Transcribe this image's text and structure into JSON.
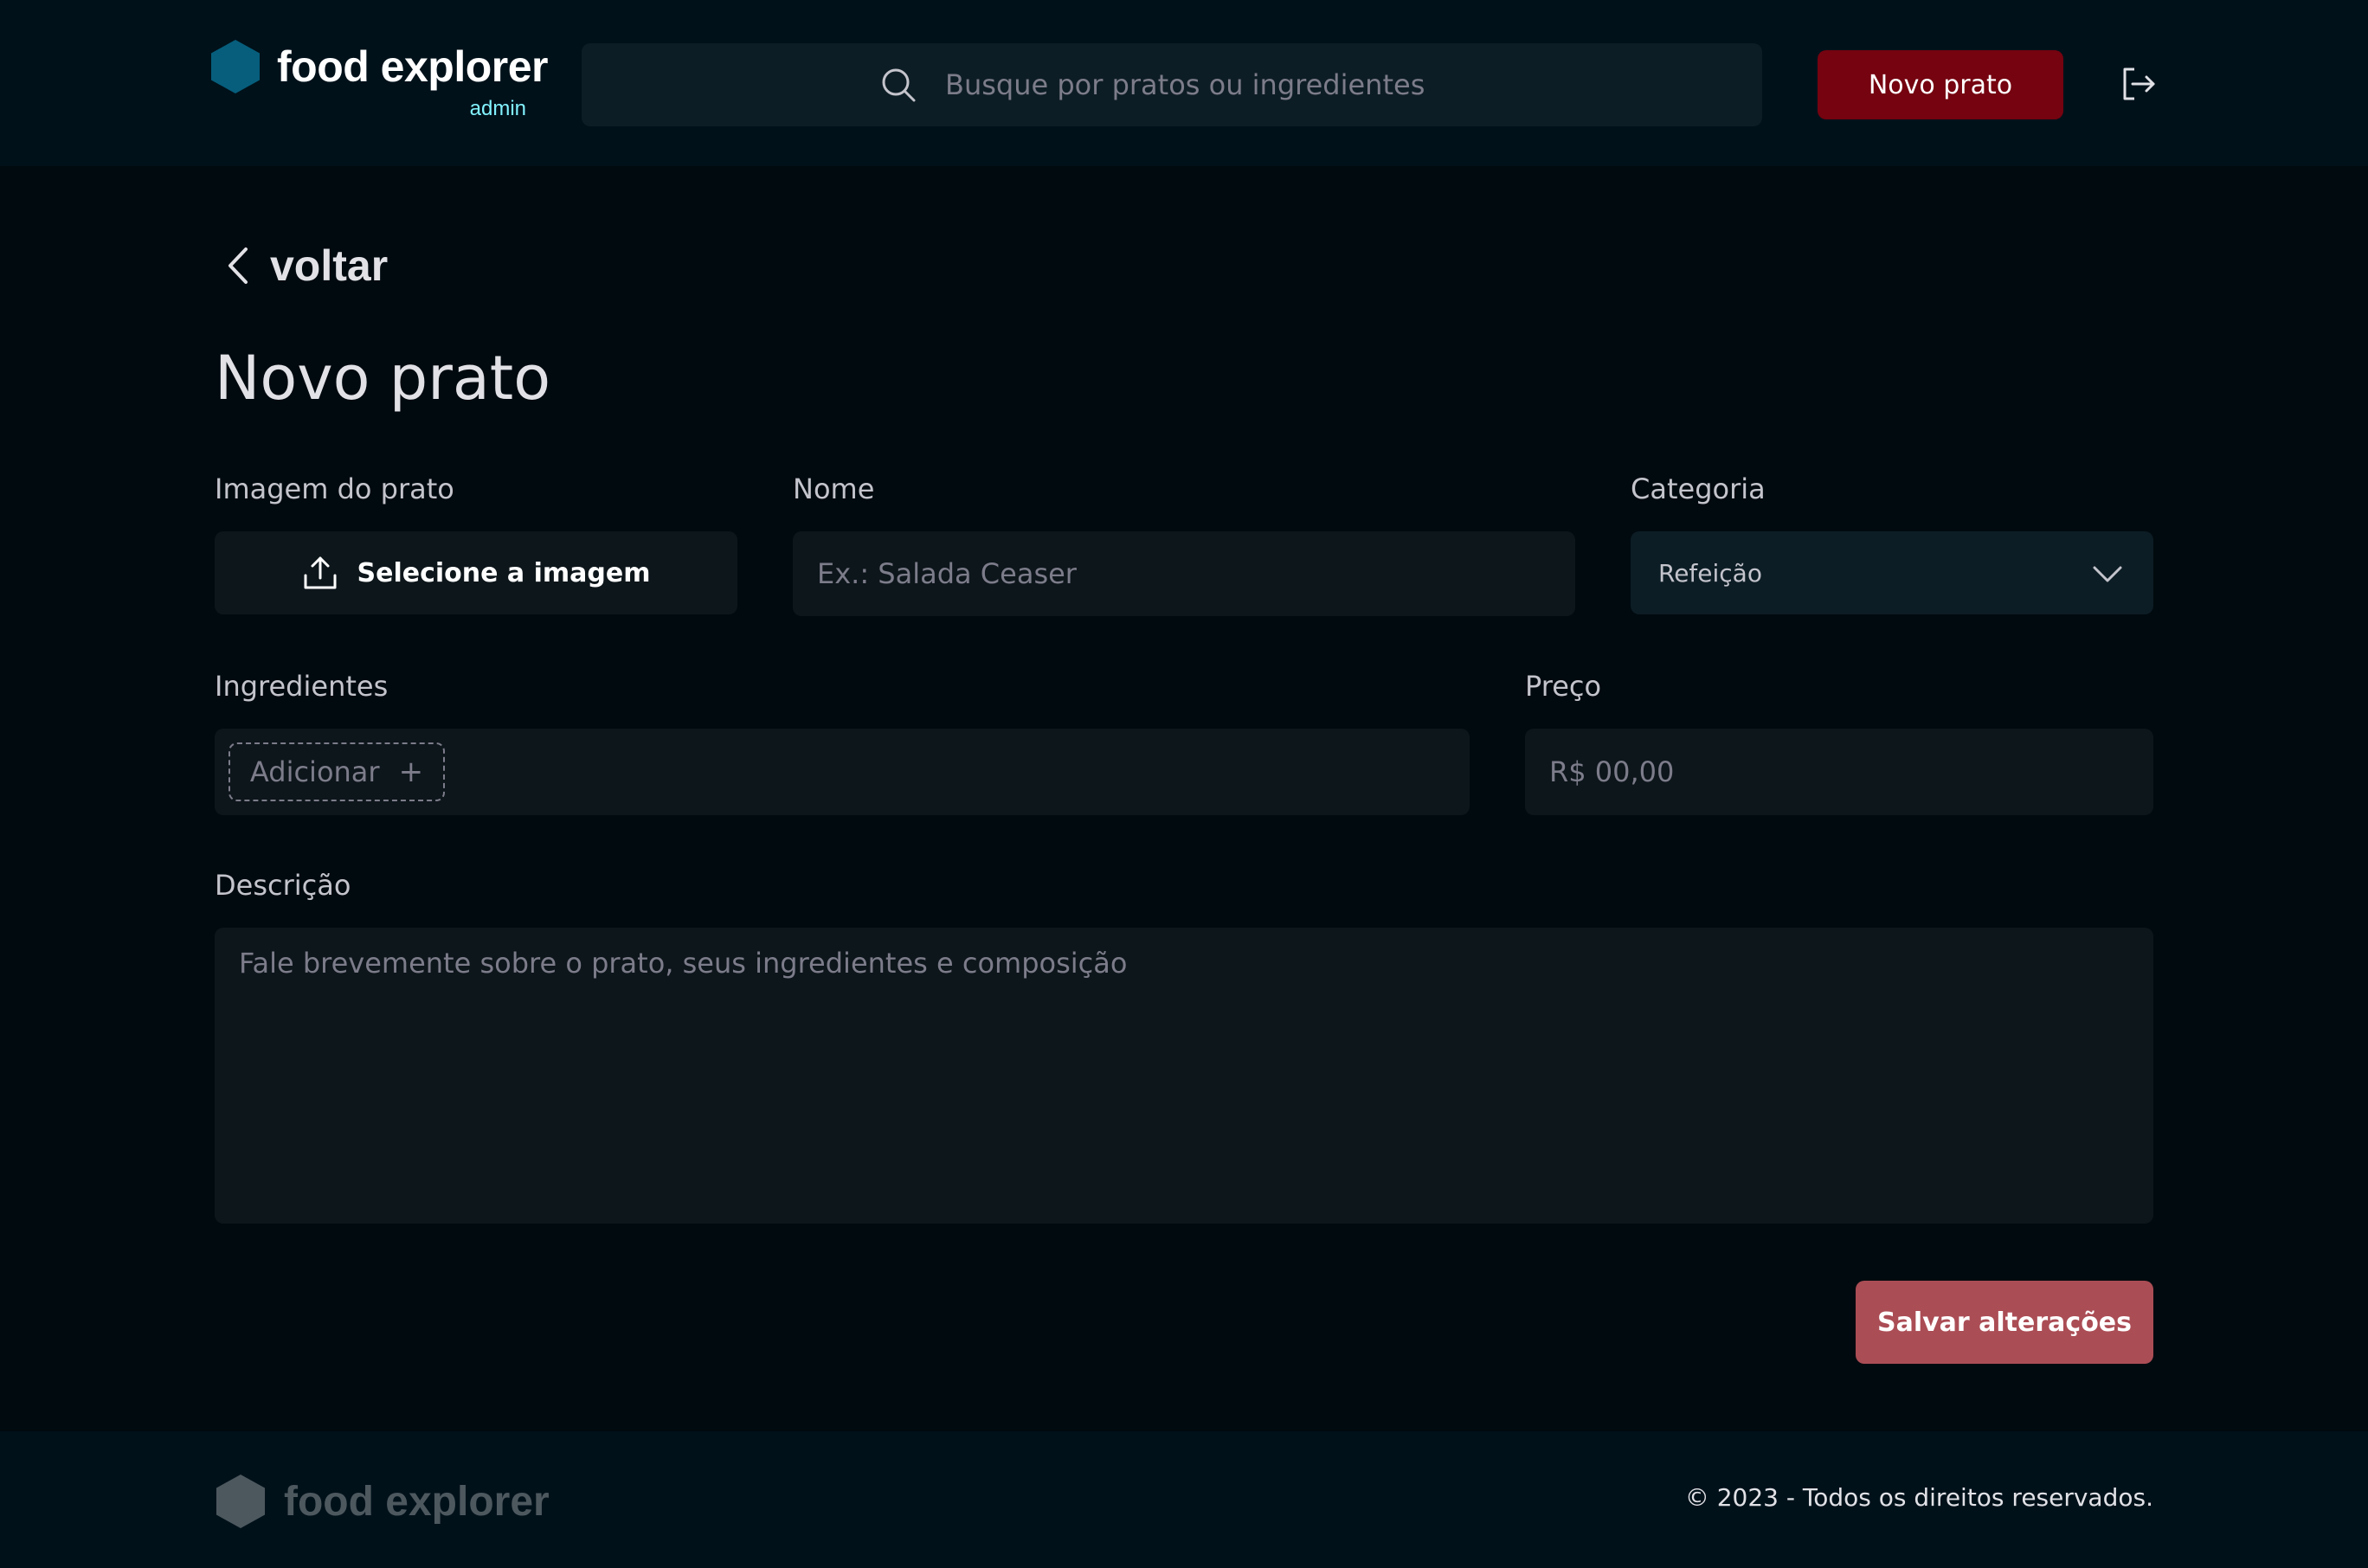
{
  "colors": {
    "background": "#000a0f",
    "header_bg": "#00111a",
    "input_bg": "#0d161b",
    "accent_red": "#750310",
    "save_button": "#ab4d55",
    "logo_cyan": "#065e7c",
    "admin_text": "#82f3ff"
  },
  "header": {
    "logo_text": "food explorer",
    "logo_badge": "admin",
    "search_placeholder": "Busque por pratos ou ingredientes",
    "new_dish_label": "Novo prato",
    "logout_icon": "sign-out-icon"
  },
  "main": {
    "back_label": "voltar",
    "title": "Novo prato",
    "image": {
      "label": "Imagem do prato",
      "button_label": "Selecione a imagem",
      "icon": "upload-icon"
    },
    "name": {
      "label": "Nome",
      "placeholder": "Ex.: Salada Ceaser"
    },
    "category": {
      "label": "Categoria",
      "selected": "Refeição"
    },
    "ingredients": {
      "label": "Ingredientes",
      "add_label": "Adicionar",
      "add_icon": "+"
    },
    "price": {
      "label": "Preço",
      "placeholder": "R$ 00,00"
    },
    "description": {
      "label": "Descrição",
      "placeholder": "Fale brevemente sobre o prato, seus ingredientes e composição"
    },
    "save_label": "Salvar alterações"
  },
  "footer": {
    "logo_text": "food explorer",
    "copyright": "© 2023 - Todos os direitos reservados."
  }
}
